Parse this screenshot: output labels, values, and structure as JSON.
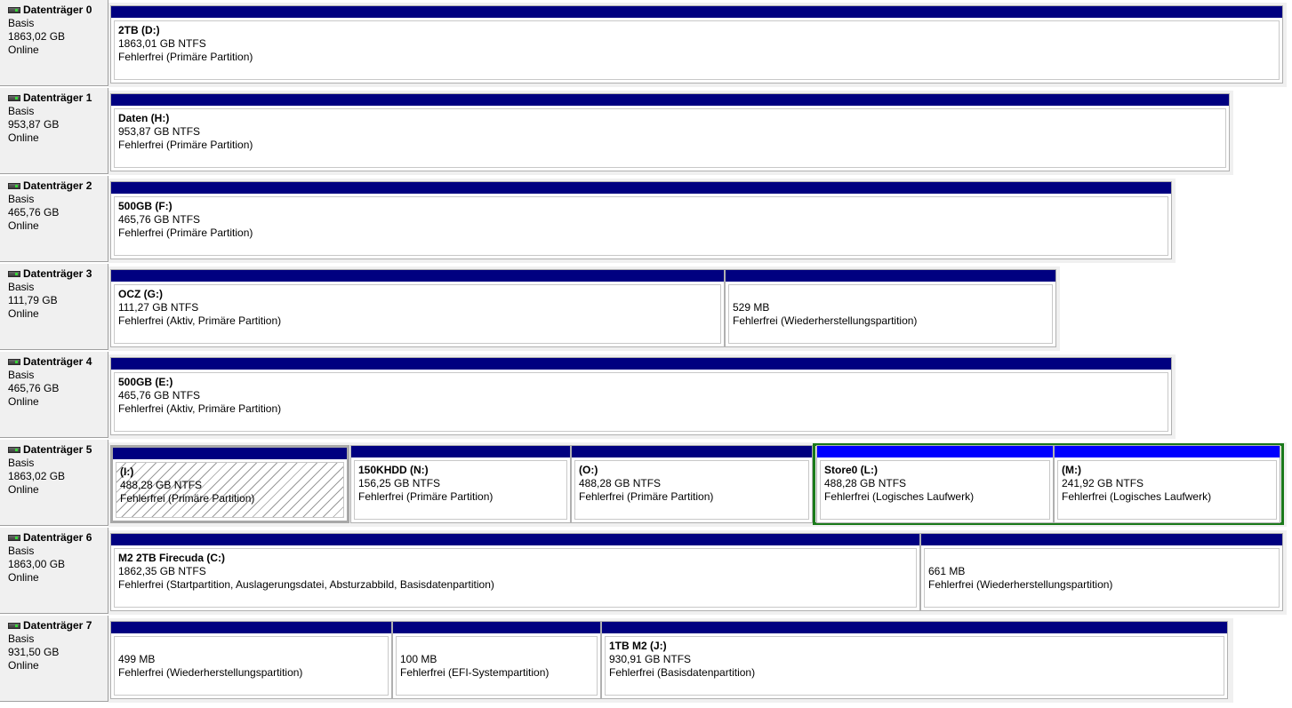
{
  "disks": [
    {
      "name": "Datenträger 0",
      "type": "Basis",
      "size": "1863,02 GB",
      "status": "Online",
      "partitions": [
        {
          "label": "2TB  (D:)",
          "size": "1863,01 GB NTFS",
          "status": "Fehlerfrei (Primäre Partition)"
        }
      ]
    },
    {
      "name": "Datenträger 1",
      "type": "Basis",
      "size": "953,87 GB",
      "status": "Online",
      "partitions": [
        {
          "label": "Daten  (H:)",
          "size": "953,87 GB NTFS",
          "status": "Fehlerfrei (Primäre Partition)"
        }
      ]
    },
    {
      "name": "Datenträger 2",
      "type": "Basis",
      "size": "465,76 GB",
      "status": "Online",
      "partitions": [
        {
          "label": "500GB  (F:)",
          "size": "465,76 GB NTFS",
          "status": "Fehlerfrei (Primäre Partition)"
        }
      ]
    },
    {
      "name": "Datenträger 3",
      "type": "Basis",
      "size": "111,79 GB",
      "status": "Online",
      "partitions": [
        {
          "label": "OCZ  (G:)",
          "size": "111,27 GB NTFS",
          "status": "Fehlerfrei (Aktiv, Primäre Partition)"
        },
        {
          "label": "",
          "size": "529 MB",
          "status": "Fehlerfrei (Wiederherstellungspartition)"
        }
      ]
    },
    {
      "name": "Datenträger 4",
      "type": "Basis",
      "size": "465,76 GB",
      "status": "Online",
      "partitions": [
        {
          "label": "500GB  (E:)",
          "size": "465,76 GB NTFS",
          "status": "Fehlerfrei (Aktiv, Primäre Partition)"
        }
      ]
    },
    {
      "name": "Datenträger 5",
      "type": "Basis",
      "size": "1863,02 GB",
      "status": "Online",
      "partitions": [
        {
          "label": "(I:)",
          "size": "488,28 GB NTFS",
          "status": "Fehlerfrei (Primäre Partition)"
        },
        {
          "label": "150KHDD  (N:)",
          "size": "156,25 GB NTFS",
          "status": "Fehlerfrei (Primäre Partition)"
        },
        {
          "label": "(O:)",
          "size": "488,28 GB NTFS",
          "status": "Fehlerfrei (Primäre Partition)"
        },
        {
          "label": "Store0  (L:)",
          "size": "488,28 GB NTFS",
          "status": "Fehlerfrei (Logisches Laufwerk)"
        },
        {
          "label": "(M:)",
          "size": "241,92 GB NTFS",
          "status": "Fehlerfrei (Logisches Laufwerk)"
        }
      ]
    },
    {
      "name": "Datenträger 6",
      "type": "Basis",
      "size": "1863,00 GB",
      "status": "Online",
      "partitions": [
        {
          "label": "M2 2TB Firecuda  (C:)",
          "size": "1862,35 GB NTFS",
          "status": "Fehlerfrei (Startpartition, Auslagerungsdatei, Absturzabbild, Basisdatenpartition)"
        },
        {
          "label": "",
          "size": "661 MB",
          "status": "Fehlerfrei (Wiederherstellungspartition)"
        }
      ]
    },
    {
      "name": "Datenträger 7",
      "type": "Basis",
      "size": "931,50 GB",
      "status": "Online",
      "partitions": [
        {
          "label": "",
          "size": "499 MB",
          "status": "Fehlerfrei (Wiederherstellungspartition)"
        },
        {
          "label": "",
          "size": "100 MB",
          "status": "Fehlerfrei (EFI-Systempartition)"
        },
        {
          "label": "1TB M2  (J:)",
          "size": "930,91 GB NTFS",
          "status": "Fehlerfrei (Basisdatenpartition)"
        }
      ]
    }
  ]
}
